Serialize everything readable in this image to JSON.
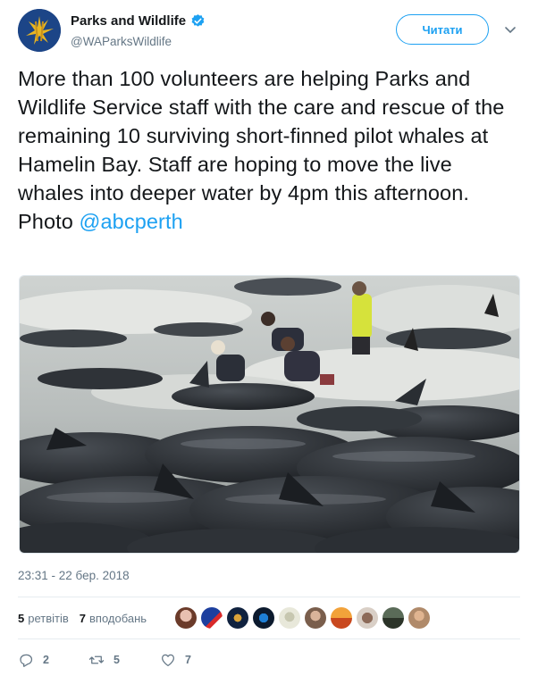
{
  "account": {
    "name": "Parks and Wildlife",
    "handle": "@WAParksWildlife",
    "verified": true
  },
  "follow_button": {
    "label": "Читати"
  },
  "tweet": {
    "text": "More than 100 volunteers are helping Parks and Wildlife Service staff with the care and rescue of the remaining 10 surviving short-finned pilot whales at Hamelin Bay. Staff are hoping to move the live whales into deeper water by 4pm this afternoon. Photo ",
    "mention": "@abcperth"
  },
  "timestamp": "23:31 - 22 бер. 2018",
  "stats": {
    "retweets_count": "5",
    "retweets_label": "ретвітів",
    "likes_count": "7",
    "likes_label": "вподобань"
  },
  "actions": {
    "reply_count": "2",
    "retweet_count": "5",
    "like_count": "7"
  },
  "colors": {
    "accent": "#1da1f2",
    "secondary_text": "#657786",
    "divider": "#e6ecf0"
  },
  "icons": [
    "verified-badge-icon",
    "chevron-down-icon",
    "reply-icon",
    "retweet-icon",
    "heart-icon"
  ]
}
